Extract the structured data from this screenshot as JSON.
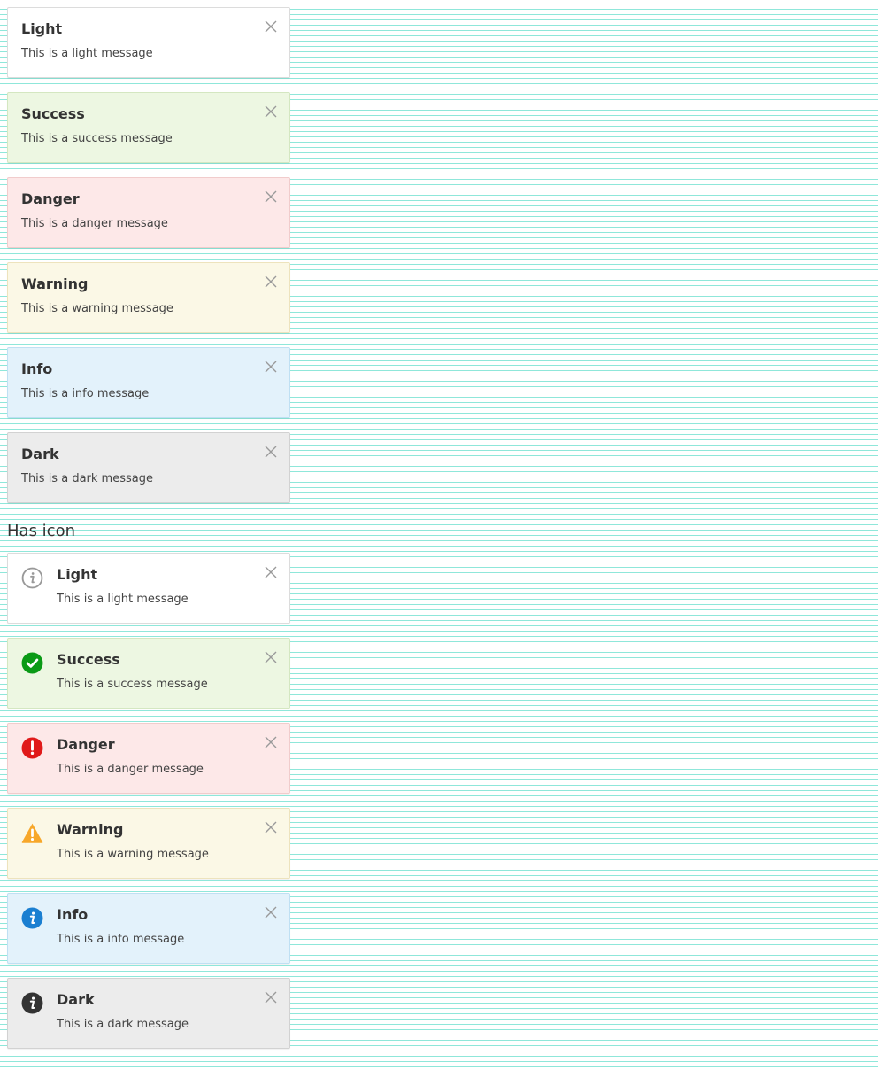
{
  "basic": {
    "items": [
      {
        "type": "light",
        "title": "Light",
        "message": "This is a light message",
        "bg": "#ffffff",
        "border": "#dcdcdc"
      },
      {
        "type": "success",
        "title": "Success",
        "message": "This is a success message",
        "bg": "#edf7e2",
        "border": "#d4e7c1"
      },
      {
        "type": "danger",
        "title": "Danger",
        "message": "This is a danger message",
        "bg": "#fde8e8",
        "border": "#f1cccc"
      },
      {
        "type": "warning",
        "title": "Warning",
        "message": "This is a warning message",
        "bg": "#fbf8e6",
        "border": "#ede3bd"
      },
      {
        "type": "info",
        "title": "Info",
        "message": "This is a info message",
        "bg": "#e3f2fb",
        "border": "#bfe0f3"
      },
      {
        "type": "dark",
        "title": "Dark",
        "message": "This is a dark message",
        "bg": "#ececec",
        "border": "#d2d2d2"
      }
    ]
  },
  "icon_section": {
    "heading": "Has icon",
    "items": [
      {
        "type": "light",
        "title": "Light",
        "message": "This is a light message",
        "icon": "info-outline-icon",
        "icon_color": "#999999",
        "bg": "#ffffff",
        "border": "#dcdcdc"
      },
      {
        "type": "success",
        "title": "Success",
        "message": "This is a success message",
        "icon": "check-circle-icon",
        "icon_color": "#0a9a16",
        "bg": "#edf7e2",
        "border": "#d4e7c1"
      },
      {
        "type": "danger",
        "title": "Danger",
        "message": "This is a danger message",
        "icon": "exclamation-circle-icon",
        "icon_color": "#e01a1a",
        "bg": "#fde8e8",
        "border": "#f1cccc"
      },
      {
        "type": "warning",
        "title": "Warning",
        "message": "This is a warning message",
        "icon": "warning-triangle-icon",
        "icon_color": "#f7a72a",
        "bg": "#fbf8e6",
        "border": "#ede3bd"
      },
      {
        "type": "info",
        "title": "Info",
        "message": "This is a info message",
        "icon": "info-circle-icon",
        "icon_color": "#1a7fd1",
        "bg": "#e3f2fb",
        "border": "#bfe0f3"
      },
      {
        "type": "dark",
        "title": "Dark",
        "message": "This is a dark message",
        "icon": "info-circle-icon",
        "icon_color": "#333333",
        "bg": "#ececec",
        "border": "#d2d2d2"
      }
    ]
  }
}
